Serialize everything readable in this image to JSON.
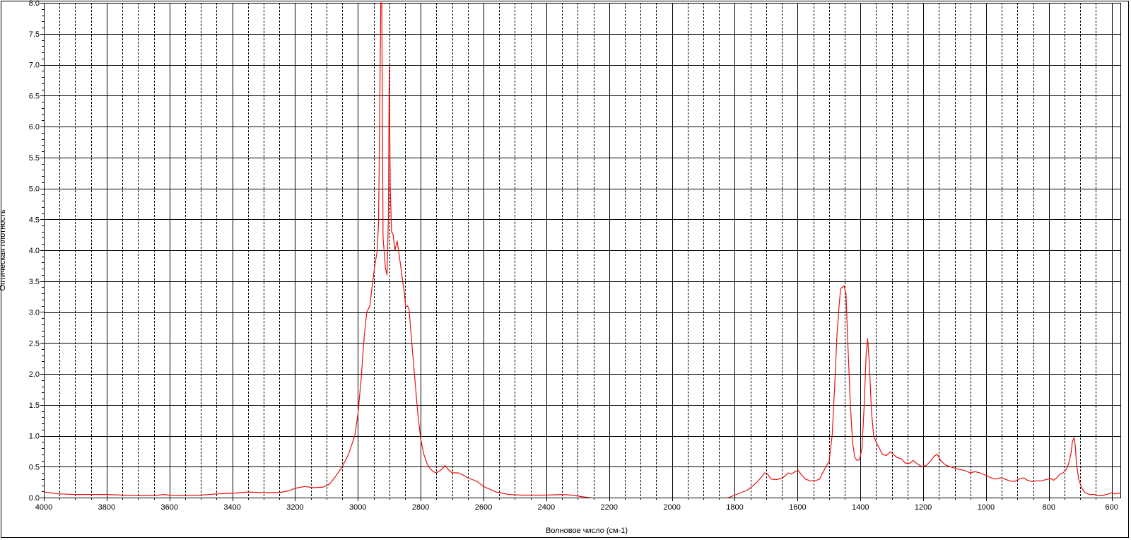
{
  "chart_data": {
    "type": "line",
    "xlabel": "Волновое число (см-1)",
    "ylabel": "Оптическая плотность",
    "xlim": [
      4000,
      570
    ],
    "ylim": [
      0.0,
      8.0
    ],
    "x_reversed": true,
    "grid": true,
    "x_ticks": [
      4000,
      3800,
      3600,
      3400,
      3200,
      3000,
      2800,
      2600,
      2400,
      2200,
      2000,
      1800,
      1600,
      1400,
      1200,
      1000,
      800,
      600
    ],
    "y_ticks": [
      "0.0",
      "0.5",
      "1.0",
      "1.5",
      "2.0",
      "2.5",
      "3.0",
      "3.5",
      "4.0",
      "4.5",
      "5.0",
      "5.5",
      "6.0",
      "6.5",
      "7.0",
      "7.5",
      "8.0"
    ],
    "colors": {
      "line": "#e8110f",
      "grid_major": "#000000",
      "grid_minor": "#000000",
      "frame": "#000000"
    },
    "series": [
      {
        "points": [
          [
            4000,
            0.09
          ],
          [
            3950,
            0.06
          ],
          [
            3900,
            0.05
          ],
          [
            3850,
            0.05
          ],
          [
            3800,
            0.05
          ],
          [
            3750,
            0.04
          ],
          [
            3700,
            0.03
          ],
          [
            3650,
            0.03
          ],
          [
            3620,
            0.05
          ],
          [
            3600,
            0.04
          ],
          [
            3560,
            0.03
          ],
          [
            3500,
            0.04
          ],
          [
            3450,
            0.06
          ],
          [
            3400,
            0.07
          ],
          [
            3350,
            0.09
          ],
          [
            3300,
            0.08
          ],
          [
            3250,
            0.08
          ],
          [
            3220,
            0.11
          ],
          [
            3200,
            0.15
          ],
          [
            3170,
            0.18
          ],
          [
            3140,
            0.16
          ],
          [
            3110,
            0.17
          ],
          [
            3090,
            0.22
          ],
          [
            3070,
            0.35
          ],
          [
            3050,
            0.5
          ],
          [
            3030,
            0.7
          ],
          [
            3010,
            1.0
          ],
          [
            3000,
            1.35
          ],
          [
            2990,
            1.9
          ],
          [
            2980,
            2.6
          ],
          [
            2972,
            3.0
          ],
          [
            2962,
            3.1
          ],
          [
            2955,
            3.4
          ],
          [
            2945,
            3.8
          ],
          [
            2938,
            4.0
          ],
          [
            2934,
            4.5
          ],
          [
            2930,
            6.5
          ],
          [
            2927,
            8.0
          ],
          [
            2924,
            8.0
          ],
          [
            2920,
            4.2
          ],
          [
            2912,
            3.7
          ],
          [
            2907,
            3.6
          ],
          [
            2903,
            4.5
          ],
          [
            2900,
            6.96
          ],
          [
            2897,
            5.0
          ],
          [
            2893,
            4.3
          ],
          [
            2888,
            4.25
          ],
          [
            2882,
            4.0
          ],
          [
            2875,
            4.15
          ],
          [
            2868,
            3.9
          ],
          [
            2860,
            3.6
          ],
          [
            2852,
            3.3
          ],
          [
            2848,
            3.08
          ],
          [
            2842,
            3.1
          ],
          [
            2837,
            3.05
          ],
          [
            2830,
            2.6
          ],
          [
            2820,
            2.0
          ],
          [
            2810,
            1.4
          ],
          [
            2800,
            0.95
          ],
          [
            2790,
            0.7
          ],
          [
            2780,
            0.55
          ],
          [
            2770,
            0.47
          ],
          [
            2760,
            0.42
          ],
          [
            2750,
            0.4
          ],
          [
            2740,
            0.43
          ],
          [
            2730,
            0.47
          ],
          [
            2722,
            0.52
          ],
          [
            2712,
            0.45
          ],
          [
            2700,
            0.4
          ],
          [
            2680,
            0.4
          ],
          [
            2670,
            0.38
          ],
          [
            2650,
            0.32
          ],
          [
            2620,
            0.26
          ],
          [
            2600,
            0.18
          ],
          [
            2560,
            0.09
          ],
          [
            2520,
            0.05
          ],
          [
            2480,
            0.04
          ],
          [
            2440,
            0.04
          ],
          [
            2400,
            0.04
          ],
          [
            2350,
            0.05
          ],
          [
            2320,
            0.04
          ],
          [
            2280,
            0.01
          ],
          [
            2250,
            -0.01
          ],
          [
            2200,
            -0.02
          ],
          [
            2150,
            -0.02
          ],
          [
            2100,
            -0.03
          ],
          [
            2050,
            -0.03
          ],
          [
            2000,
            -0.04
          ],
          [
            1950,
            -0.03
          ],
          [
            1900,
            -0.02
          ],
          [
            1870,
            -0.02
          ],
          [
            1840,
            -0.03
          ],
          [
            1820,
            0.0
          ],
          [
            1800,
            0.04
          ],
          [
            1780,
            0.08
          ],
          [
            1760,
            0.12
          ],
          [
            1740,
            0.2
          ],
          [
            1720,
            0.3
          ],
          [
            1705,
            0.4
          ],
          [
            1695,
            0.38
          ],
          [
            1685,
            0.3
          ],
          [
            1670,
            0.29
          ],
          [
            1650,
            0.31
          ],
          [
            1640,
            0.35
          ],
          [
            1630,
            0.4
          ],
          [
            1620,
            0.38
          ],
          [
            1608,
            0.42
          ],
          [
            1598,
            0.44
          ],
          [
            1588,
            0.37
          ],
          [
            1575,
            0.3
          ],
          [
            1560,
            0.27
          ],
          [
            1545,
            0.27
          ],
          [
            1530,
            0.3
          ],
          [
            1520,
            0.4
          ],
          [
            1510,
            0.5
          ],
          [
            1500,
            0.58
          ],
          [
            1490,
            1.0
          ],
          [
            1482,
            1.8
          ],
          [
            1475,
            2.6
          ],
          [
            1468,
            3.1
          ],
          [
            1463,
            3.38
          ],
          [
            1458,
            3.4
          ],
          [
            1452,
            3.42
          ],
          [
            1446,
            3.3
          ],
          [
            1440,
            2.5
          ],
          [
            1432,
            1.5
          ],
          [
            1425,
            0.9
          ],
          [
            1418,
            0.65
          ],
          [
            1410,
            0.6
          ],
          [
            1402,
            0.62
          ],
          [
            1395,
            0.8
          ],
          [
            1388,
            1.5
          ],
          [
            1382,
            2.3
          ],
          [
            1377,
            2.57
          ],
          [
            1372,
            2.2
          ],
          [
            1365,
            1.4
          ],
          [
            1358,
            1.0
          ],
          [
            1350,
            0.9
          ],
          [
            1340,
            0.8
          ],
          [
            1330,
            0.7
          ],
          [
            1318,
            0.68
          ],
          [
            1305,
            0.74
          ],
          [
            1295,
            0.7
          ],
          [
            1285,
            0.65
          ],
          [
            1270,
            0.63
          ],
          [
            1258,
            0.56
          ],
          [
            1245,
            0.55
          ],
          [
            1232,
            0.6
          ],
          [
            1220,
            0.55
          ],
          [
            1205,
            0.5
          ],
          [
            1190,
            0.52
          ],
          [
            1175,
            0.6
          ],
          [
            1165,
            0.67
          ],
          [
            1155,
            0.7
          ],
          [
            1145,
            0.6
          ],
          [
            1130,
            0.53
          ],
          [
            1115,
            0.5
          ],
          [
            1095,
            0.47
          ],
          [
            1070,
            0.44
          ],
          [
            1050,
            0.4
          ],
          [
            1035,
            0.42
          ],
          [
            1020,
            0.4
          ],
          [
            1000,
            0.36
          ],
          [
            985,
            0.32
          ],
          [
            970,
            0.3
          ],
          [
            955,
            0.32
          ],
          [
            940,
            0.3
          ],
          [
            925,
            0.27
          ],
          [
            910,
            0.26
          ],
          [
            895,
            0.3
          ],
          [
            880,
            0.32
          ],
          [
            868,
            0.28
          ],
          [
            855,
            0.26
          ],
          [
            840,
            0.27
          ],
          [
            825,
            0.27
          ],
          [
            810,
            0.29
          ],
          [
            795,
            0.31
          ],
          [
            785,
            0.28
          ],
          [
            775,
            0.32
          ],
          [
            765,
            0.38
          ],
          [
            755,
            0.4
          ],
          [
            745,
            0.45
          ],
          [
            737,
            0.55
          ],
          [
            730,
            0.7
          ],
          [
            725,
            0.9
          ],
          [
            720,
            0.97
          ],
          [
            716,
            0.85
          ],
          [
            712,
            0.55
          ],
          [
            705,
            0.3
          ],
          [
            695,
            0.15
          ],
          [
            685,
            0.08
          ],
          [
            670,
            0.05
          ],
          [
            655,
            0.05
          ],
          [
            640,
            0.03
          ],
          [
            625,
            0.04
          ],
          [
            610,
            0.06
          ],
          [
            600,
            0.08
          ],
          [
            590,
            0.06
          ],
          [
            580,
            0.07
          ],
          [
            570,
            0.07
          ]
        ]
      }
    ]
  }
}
